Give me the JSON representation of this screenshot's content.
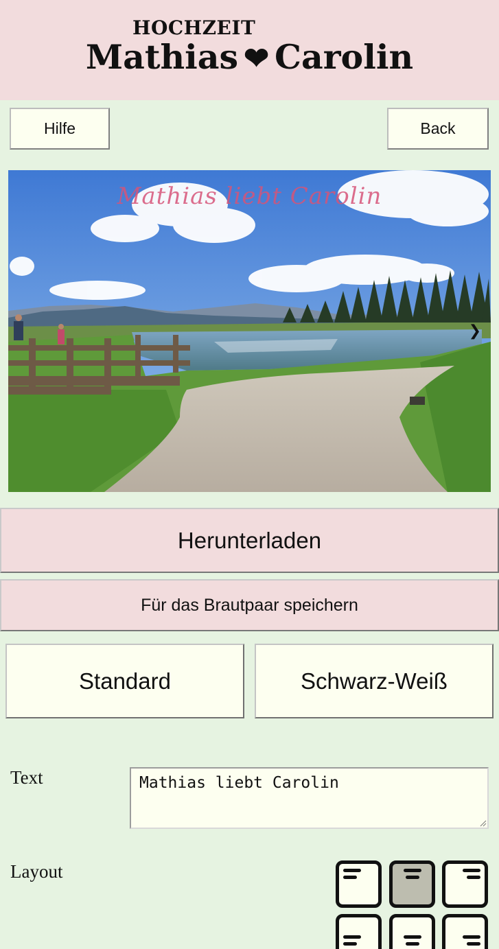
{
  "header": {
    "kicker": "HOCHZEIT",
    "name_left": "Mathias",
    "heart": "❤",
    "name_right": "Carolin"
  },
  "toolbar": {
    "help_label": "Hilfe",
    "back_label": "Back"
  },
  "photo": {
    "overlay_text": "Mathias liebt Carolin",
    "next_glyph": "❯"
  },
  "actions": {
    "download_label": "Herunterladen",
    "save_label": "Für das Brautpaar speichern"
  },
  "modes": {
    "standard_label": "Standard",
    "bw_label": "Schwarz-Weiß"
  },
  "form": {
    "text_label": "Text",
    "text_value": "Mathias liebt Carolin",
    "layout_label": "Layout",
    "layout_options": [
      {
        "name": "top-left",
        "selected": false
      },
      {
        "name": "top-center",
        "selected": true
      },
      {
        "name": "top-right",
        "selected": false
      },
      {
        "name": "bottom-left",
        "selected": false
      },
      {
        "name": "bottom-center",
        "selected": false
      },
      {
        "name": "bottom-right",
        "selected": false
      }
    ]
  },
  "colors": {
    "page_background": "#e6f3e1",
    "header_background": "#f2dcdd",
    "button_light": "#fdfff0",
    "button_pink": "#f2dcdd",
    "layout_selected": "#bdbdaf",
    "overlay_text": "#d65478"
  }
}
